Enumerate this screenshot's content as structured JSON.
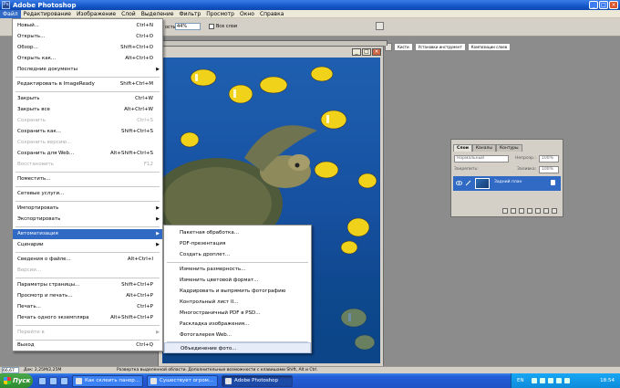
{
  "window": {
    "title": "Adobe Photoshop",
    "controls": [
      "_",
      "□",
      "×"
    ]
  },
  "menubar": [
    "Файл",
    "Редактирование",
    "Изображение",
    "Слой",
    "Выделение",
    "Фильтр",
    "Просмотр",
    "Окно",
    "Справка"
  ],
  "options": {
    "label": "ость:",
    "value": "44%",
    "checkbox": "Все слои"
  },
  "well_tabs": [
    "Кисти",
    "Установки инструмент",
    "Композиции слоев"
  ],
  "file_menu": {
    "items": [
      {
        "label": "Новый...",
        "shortcut": "Ctrl+N"
      },
      {
        "label": "Открыть...",
        "shortcut": "Ctrl+O"
      },
      {
        "label": "Обзор...",
        "shortcut": "Shift+Ctrl+O"
      },
      {
        "label": "Открыть как...",
        "shortcut": "Alt+Ctrl+O"
      },
      {
        "label": "Последние документы",
        "shortcut": ""
      },
      {
        "label": "Редактировать в ImageReady",
        "shortcut": "Shift+Ctrl+M"
      },
      {
        "label": "Закрыть",
        "shortcut": "Ctrl+W"
      },
      {
        "label": "Закрыть все",
        "shortcut": "Alt+Ctrl+W"
      },
      {
        "label": "Сохранить",
        "shortcut": "Ctrl+S"
      },
      {
        "label": "Сохранить как...",
        "shortcut": "Shift+Ctrl+S"
      },
      {
        "label": "Сохранить версию...",
        "shortcut": ""
      },
      {
        "label": "Сохранить для Web...",
        "shortcut": "Alt+Shift+Ctrl+S"
      },
      {
        "label": "Восстановить",
        "shortcut": "F12"
      },
      {
        "label": "Поместить...",
        "shortcut": ""
      },
      {
        "label": "Сетевые услуги...",
        "shortcut": ""
      },
      {
        "label": "Импортировать",
        "shortcut": ""
      },
      {
        "label": "Экспортировать",
        "shortcut": ""
      },
      {
        "label": "Автоматизация",
        "shortcut": ""
      },
      {
        "label": "Сценарии",
        "shortcut": ""
      },
      {
        "label": "Сведения о файле...",
        "shortcut": "Alt+Ctrl+I"
      },
      {
        "label": "Версии...",
        "shortcut": ""
      },
      {
        "label": "Параметры страницы...",
        "shortcut": "Shift+Ctrl+P"
      },
      {
        "label": "Просмотр и печать...",
        "shortcut": "Alt+Ctrl+P"
      },
      {
        "label": "Печать...",
        "shortcut": "Ctrl+P"
      },
      {
        "label": "Печать одного экземпляра",
        "shortcut": "Alt+Shift+Ctrl+P"
      },
      {
        "label": "Перейти в",
        "shortcut": ""
      },
      {
        "label": "Выход",
        "shortcut": "Ctrl+Q"
      }
    ]
  },
  "automation_submenu": {
    "items": [
      "Пакетная обработка...",
      "PDF-презентация",
      "Создать дроплет...",
      "Изменить размерность...",
      "Изменить цветовой формат...",
      "Кадрировать и выпрямить фотографию",
      "Контрольный лист II...",
      "Многостраничный PDF в PSD...",
      "Раскладка изображения...",
      "Фотогалерея Web...",
      "Объединение фото..."
    ]
  },
  "layers_panel": {
    "tabs": [
      "Слои",
      "Каналы",
      "Контуры"
    ],
    "blend_mode": "Нормальный",
    "opacity_label": "Непрозр.:",
    "opacity_value": "100%",
    "lock_label": "Закрепить:",
    "fill_label": "Заливка:",
    "fill_value": "100%",
    "layer_name": "Задний план"
  },
  "status": {
    "zoom": "66,67 %",
    "doc": "Док: 2,25М/2,25М",
    "hint": "Развертка выделенной области. Дополнительные возможности с клавишами Shift, Alt и Ctrl."
  },
  "taskbar": {
    "start": "Пуск",
    "tasks": [
      "Как склеить панор...",
      "Сушествует огром...",
      "Adobe Photoshop"
    ],
    "lang": "EN",
    "clock": "18:54"
  },
  "colors": {
    "menu_highlight": "#316ac5",
    "taskbar": "#245edb",
    "canvas_bg": "#8c8c8c"
  }
}
